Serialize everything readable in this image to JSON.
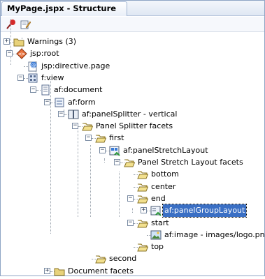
{
  "window": {
    "tab_title": "MyPage.jspx - Structure"
  },
  "toolbar": {
    "buttons": [
      {
        "name": "pin-icon"
      },
      {
        "name": "edit-icon"
      }
    ]
  },
  "colors": {
    "selection": "#3a6fc4",
    "folder": "#e8d27a"
  },
  "tree": {
    "nodes": [
      {
        "label": "Warnings (3)",
        "icon": "folder-icon",
        "expander": "+"
      },
      {
        "label": "jsp:root",
        "icon": "xml-tag-icon",
        "expander": "−"
      },
      {
        "label": "jsp:directive.page",
        "icon": "directive-icon"
      },
      {
        "label": "f:view",
        "icon": "view-icon",
        "expander": "−"
      },
      {
        "label": "af:document",
        "icon": "document-icon",
        "expander": "−"
      },
      {
        "label": "af:form",
        "icon": "form-icon",
        "expander": "−"
      },
      {
        "label": "af:panelSplitter - vertical",
        "icon": "panel-splitter-icon",
        "expander": "−"
      },
      {
        "label": "Panel Splitter facets",
        "icon": "open-folder-icon",
        "expander": "−"
      },
      {
        "label": "first",
        "icon": "open-folder-icon",
        "expander": "−"
      },
      {
        "label": "af:panelStretchLayout",
        "icon": "panel-stretch-icon",
        "expander": "−"
      },
      {
        "label": "Panel Stretch Layout facets",
        "icon": "open-folder-icon",
        "expander": "−"
      },
      {
        "label": "bottom",
        "icon": "open-folder-icon"
      },
      {
        "label": "center",
        "icon": "open-folder-icon"
      },
      {
        "label": "end",
        "icon": "open-folder-icon",
        "expander": "−"
      },
      {
        "label": "af:panelGroupLayout",
        "icon": "panel-group-icon",
        "expander": "+",
        "selected": true
      },
      {
        "label": "start",
        "icon": "open-folder-icon",
        "expander": "−"
      },
      {
        "label": "af:image - images/logo.png",
        "icon": "image-icon"
      },
      {
        "label": "top",
        "icon": "open-folder-icon"
      },
      {
        "label": "second",
        "icon": "open-folder-icon"
      },
      {
        "label": "Document facets",
        "icon": "folder-icon",
        "expander": "+"
      }
    ]
  }
}
